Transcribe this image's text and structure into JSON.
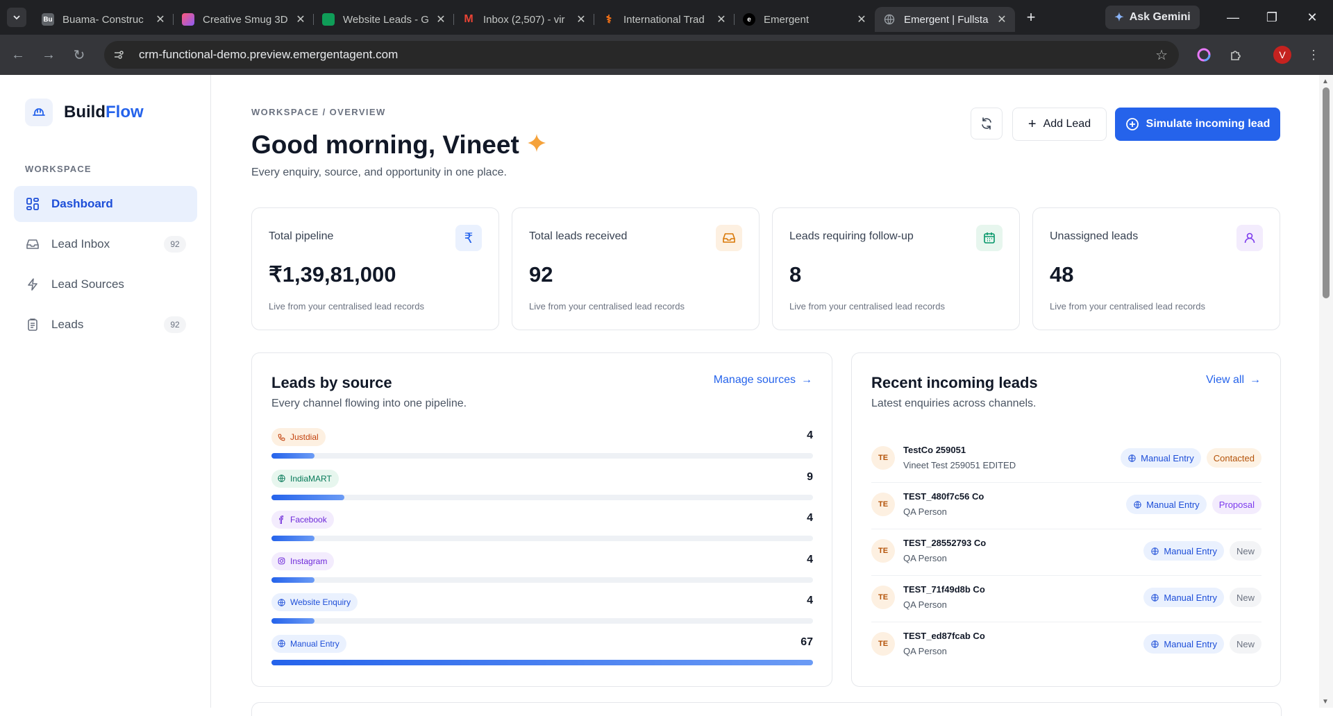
{
  "browser": {
    "tabs": [
      {
        "title": "Buama- Construc",
        "favicon": "Bu"
      },
      {
        "title": "Creative Smug 3D",
        "favicon": ""
      },
      {
        "title": "Website Leads - G",
        "favicon": ""
      },
      {
        "title": "Inbox (2,507) - vir",
        "favicon": "M"
      },
      {
        "title": "International Trad",
        "favicon": ""
      },
      {
        "title": "Emergent",
        "favicon": "e"
      },
      {
        "title": "Emergent | Fullsta",
        "favicon": ""
      }
    ],
    "gemini_label": "Ask Gemini",
    "url": "crm-functional-demo.preview.emergentagent.com",
    "profile_initial": "V"
  },
  "sidebar": {
    "brand_first": "Build",
    "brand_second": "Flow",
    "section_label": "WORKSPACE",
    "items": [
      {
        "label": "Dashboard",
        "icon": "grid-icon"
      },
      {
        "label": "Lead Inbox",
        "count": "92",
        "icon": "inbox-icon"
      },
      {
        "label": "Lead Sources",
        "icon": "bolt-icon"
      },
      {
        "label": "Leads",
        "count": "92",
        "icon": "clipboard-icon"
      }
    ]
  },
  "header": {
    "breadcrumb": "WORKSPACE / OVERVIEW",
    "greeting": "Good morning, Vineet",
    "subtitle": "Every enquiry, source, and opportunity in one place.",
    "add_lead_label": "Add Lead",
    "simulate_label": "Simulate incoming lead"
  },
  "stats": [
    {
      "label": "Total pipeline",
      "value": "₹1,39,81,000",
      "note": "Live from your centralised lead records",
      "icon": "rupee-icon",
      "color": "#2563eb"
    },
    {
      "label": "Total leads received",
      "value": "92",
      "note": "Live from your centralised lead records",
      "icon": "tray-icon",
      "color": "#d97706"
    },
    {
      "label": "Leads requiring follow-up",
      "value": "8",
      "note": "Live from your centralised lead records",
      "icon": "calendar-icon",
      "color": "#059669"
    },
    {
      "label": "Unassigned leads",
      "value": "48",
      "note": "Live from your centralised lead records",
      "icon": "user-icon",
      "color": "#7c3aed"
    }
  ],
  "sources_card": {
    "title": "Leads by source",
    "description": "Every channel flowing into one pipeline.",
    "link_label": "Manage sources",
    "sources": [
      {
        "name": "Justdial",
        "count": 4,
        "share": 0.08,
        "color": "#c2410c",
        "bg": "#fdf0e1"
      },
      {
        "name": "IndiaMART",
        "count": 9,
        "share": 0.135,
        "color": "#047857",
        "bg": "#e7f6ee"
      },
      {
        "name": "Facebook",
        "count": 4,
        "share": 0.08,
        "color": "#6d28d9",
        "bg": "#f3ecfd"
      },
      {
        "name": "Instagram",
        "count": 4,
        "share": 0.08,
        "color": "#6d28d9",
        "bg": "#f3ecfd"
      },
      {
        "name": "Website Enquiry",
        "count": 4,
        "share": 0.08,
        "color": "#1d4ed8",
        "bg": "#eaf1fe"
      },
      {
        "name": "Manual Entry",
        "count": 67,
        "share": 1.0,
        "color": "#1d4ed8",
        "bg": "#eaf1fe"
      }
    ]
  },
  "recent_card": {
    "title": "Recent incoming leads",
    "description": "Latest enquiries across channels.",
    "link_label": "View all",
    "leads": [
      {
        "initials": "TE",
        "company": "TestCo 259051",
        "person": "Vineet Test 259051 EDITED",
        "source": "Manual Entry",
        "status": "Contacted",
        "status_class": "st-contacted"
      },
      {
        "initials": "TE",
        "company": "TEST_480f7c56 Co",
        "person": "QA Person",
        "source": "Manual Entry",
        "status": "Proposal",
        "status_class": "st-proposal"
      },
      {
        "initials": "TE",
        "company": "TEST_28552793 Co",
        "person": "QA Person",
        "source": "Manual Entry",
        "status": "New",
        "status_class": "st-new"
      },
      {
        "initials": "TE",
        "company": "TEST_71f49d8b Co",
        "person": "QA Person",
        "source": "Manual Entry",
        "status": "New",
        "status_class": "st-new"
      },
      {
        "initials": "TE",
        "company": "TEST_ed87fcab Co",
        "person": "QA Person",
        "source": "Manual Entry",
        "status": "New",
        "status_class": "st-new"
      }
    ]
  }
}
